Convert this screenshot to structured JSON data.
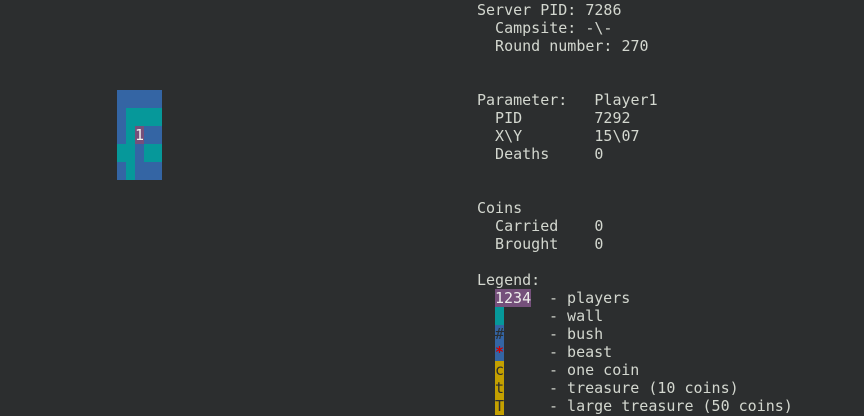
{
  "server": {
    "pid_line": "Server PID: 7286",
    "campsite_line": "  Campsite: -\\-",
    "round_line": "  Round number: 270"
  },
  "params": {
    "header": "Parameter:   Player1",
    "pid": "  PID        7292",
    "xy": "  X\\Y        15\\07",
    "deaths": "  Deaths     0"
  },
  "coins": {
    "header": "Coins",
    "carried": "  Carried    0",
    "brought": "  Brought    0"
  },
  "legend": {
    "header": "Legend:",
    "players_symbol": "1234",
    "players_desc": "- players",
    "wall_desc": "- wall",
    "bush_symbol": "#",
    "bush_desc": "- bush",
    "beast_symbol": "*",
    "beast_desc": "- beast",
    "coin_symbol": "c",
    "coin_desc": "- one coin",
    "treasure_symbol": "t",
    "treasure_desc": "- treasure (10 coins)",
    "large_treasure_symbol": "T",
    "large_treasure_desc": "- large treasure (50 coins)"
  },
  "map": {
    "player_label": "1"
  },
  "colors": {
    "background": "#2c2e2f",
    "foreground": "#d3d7cf",
    "wall": "#06989a",
    "bush": "#3465a4",
    "player": "#75507b",
    "coin": "#c4a000",
    "beast": "#cc0000"
  }
}
